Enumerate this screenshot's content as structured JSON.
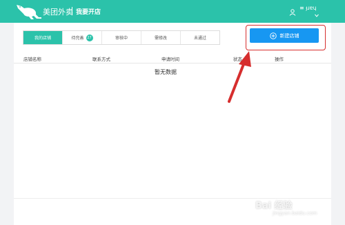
{
  "header": {
    "brand": "美团外卖",
    "subtitle": "我要开店",
    "user_name": "≡ ɟɹɐɥ",
    "logo_icon": "kangaroo-logo-icon",
    "user_icon": "user-icon",
    "dropdown_icon": "chevron-down-icon"
  },
  "tabs": [
    {
      "label": "我的店铺",
      "active": true
    },
    {
      "label": "待完善",
      "badge": "27"
    },
    {
      "label": "审核中"
    },
    {
      "label": "需修改"
    },
    {
      "label": "未通过"
    }
  ],
  "new_store_button": {
    "label": "新建店铺",
    "icon": "plus-circle-icon"
  },
  "table": {
    "columns": [
      "店铺名称",
      "联系方式",
      "申请时间",
      "状态",
      "操作"
    ],
    "empty_text": "暂无数据"
  },
  "watermark": {
    "text": "Bai 经验",
    "url": "jingyan.baidu.com"
  },
  "colors": {
    "header_bg": "#2bc2aa",
    "active_tab": "#2bc2aa",
    "primary_button": "#1797f2",
    "annotation": "#d62e2e"
  }
}
